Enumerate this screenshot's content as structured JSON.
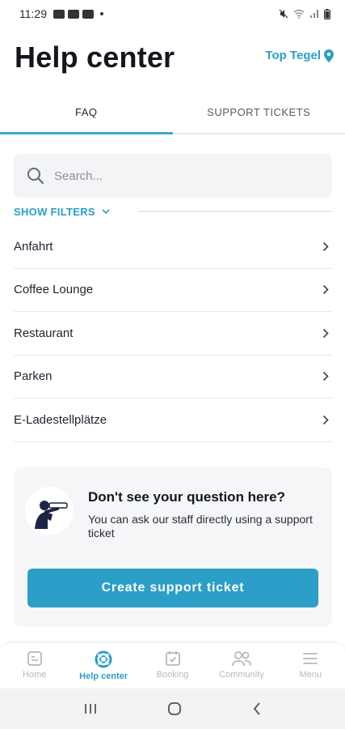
{
  "status_bar": {
    "time": "11:29"
  },
  "header": {
    "title": "Help center",
    "location": "Top Tegel"
  },
  "tabs": [
    {
      "label": "FAQ",
      "active": true
    },
    {
      "label": "SUPPORT TICKETS",
      "active": false
    }
  ],
  "search": {
    "placeholder": "Search..."
  },
  "filters": {
    "label": "SHOW FILTERS"
  },
  "faq_items": [
    {
      "label": "Anfahrt"
    },
    {
      "label": "Coffee Lounge"
    },
    {
      "label": "Restaurant"
    },
    {
      "label": "Parken"
    },
    {
      "label": "E-Ladestellplätze"
    }
  ],
  "support_card": {
    "title": "Don't see your question here?",
    "text": "You can ask our staff directly using a support ticket",
    "button": "Create support ticket"
  },
  "bottom_nav": [
    {
      "label": "Home",
      "icon": "home-icon",
      "active": false
    },
    {
      "label": "Help center",
      "icon": "lifebuoy-icon",
      "active": true
    },
    {
      "label": "Booking",
      "icon": "calendar-check-icon",
      "active": false
    },
    {
      "label": "Community",
      "icon": "people-icon",
      "active": false
    },
    {
      "label": "Menu",
      "icon": "hamburger-icon",
      "active": false
    }
  ],
  "colors": {
    "accent": "#2b9fc7",
    "text": "#1f2330",
    "inactive": "#b4b8c0"
  }
}
